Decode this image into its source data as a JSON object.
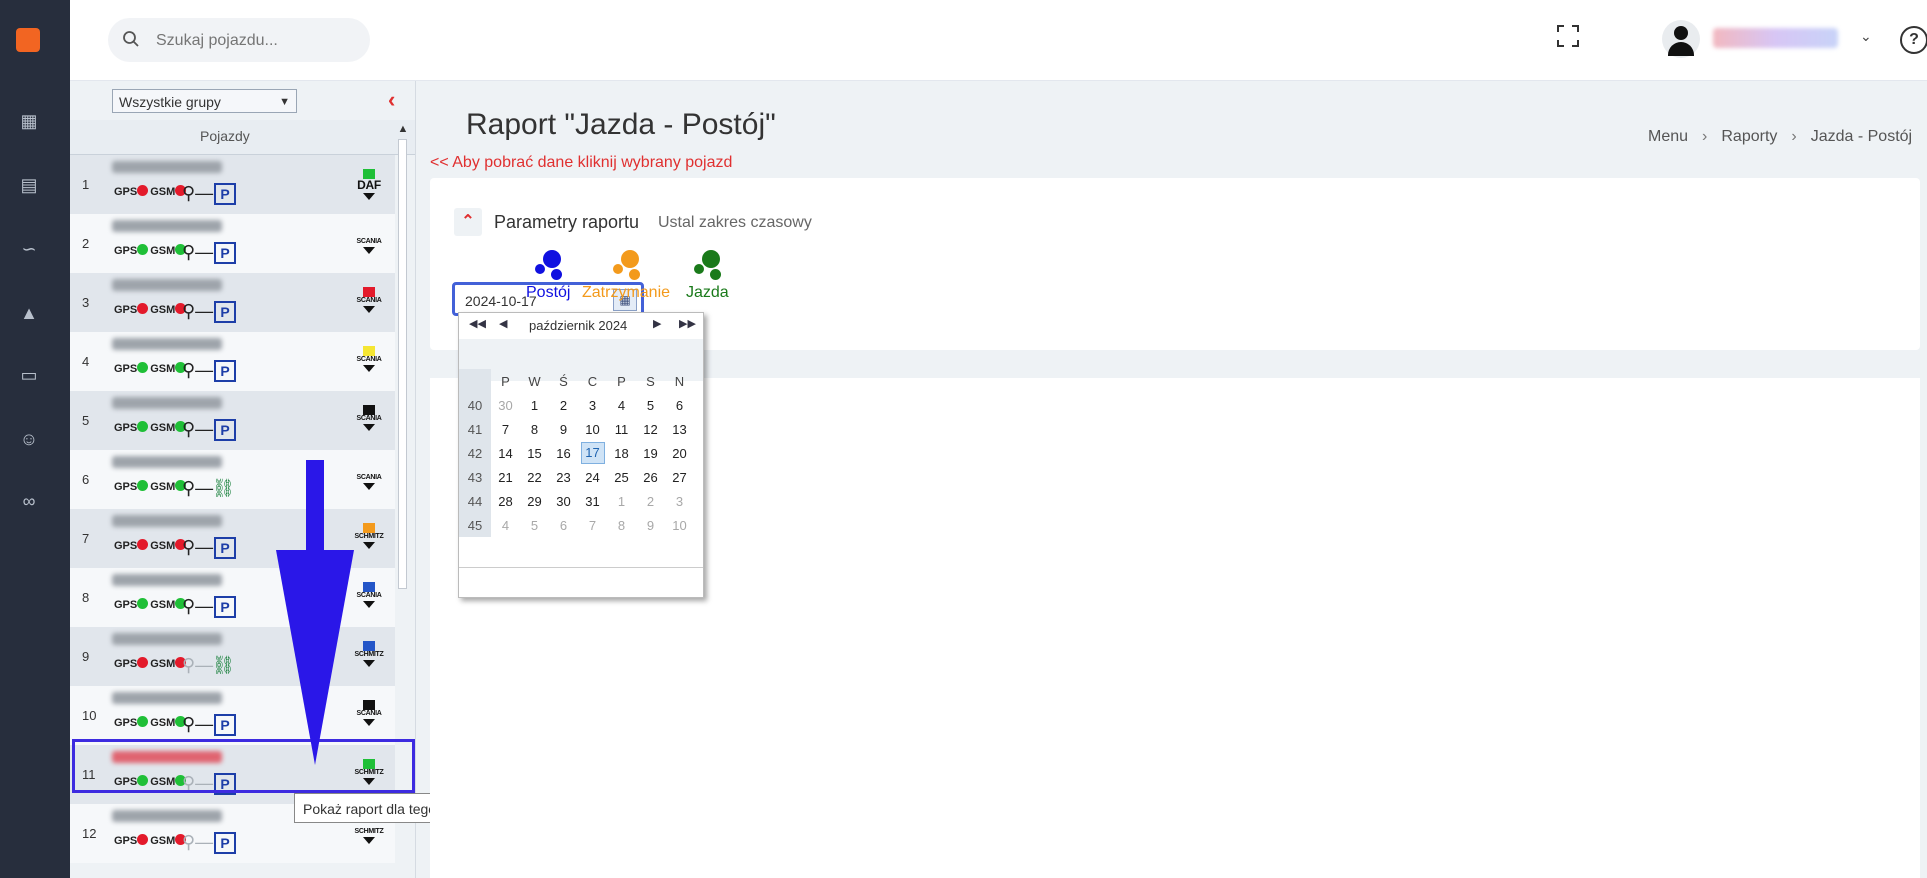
{
  "topbar": {
    "search_placeholder": "Szukaj pojazdu..."
  },
  "left_panel": {
    "group_select": "Wszystkie grupy",
    "column_header": "Pojazdy",
    "tooltip": "Pokaż raport dla tego pojazdu",
    "vehicles": [
      {
        "num": "1",
        "gps": "GPS",
        "gsm": "GSM",
        "gps_status": "red",
        "gsm_status": "red",
        "key": "black",
        "mode": "P",
        "brand": "DAF",
        "flag": "#1fbf37"
      },
      {
        "num": "2",
        "gps": "GPS",
        "gsm": "GSM",
        "gps_status": "green",
        "gsm_status": "green",
        "key": "black",
        "mode": "P",
        "brand": "SCANIA",
        "flag": ""
      },
      {
        "num": "3",
        "gps": "GPS",
        "gsm": "GSM",
        "gps_status": "red",
        "gsm_status": "red",
        "key": "black",
        "mode": "P",
        "brand": "SCANIA",
        "flag": "#e31a2b"
      },
      {
        "num": "4",
        "gps": "GPS",
        "gsm": "GSM",
        "gps_status": "green",
        "gsm_status": "green",
        "key": "black",
        "mode": "P",
        "brand": "SCANIA",
        "flag": "#f5e633"
      },
      {
        "num": "5",
        "gps": "GPS",
        "gsm": "GSM",
        "gps_status": "green",
        "gsm_status": "green",
        "key": "black",
        "mode": "P",
        "brand": "SCANIA",
        "flag": "#111111"
      },
      {
        "num": "6",
        "gps": "GPS",
        "gsm": "GSM",
        "gps_status": "green",
        "gsm_status": "green",
        "key": "black",
        "mode": "car",
        "brand": "SCANIA",
        "flag": ""
      },
      {
        "num": "7",
        "gps": "GPS",
        "gsm": "GSM",
        "gps_status": "red",
        "gsm_status": "red",
        "key": "black",
        "mode": "P",
        "brand": "SCHMITZ",
        "flag": "#f39a1c"
      },
      {
        "num": "8",
        "gps": "GPS",
        "gsm": "GSM",
        "gps_status": "green",
        "gsm_status": "green",
        "key": "black",
        "mode": "P",
        "brand": "SCANIA",
        "flag": "#2456c8"
      },
      {
        "num": "9",
        "gps": "GPS",
        "gsm": "GSM",
        "gps_status": "red",
        "gsm_status": "red",
        "key": "grey",
        "mode": "car",
        "brand": "SCHMITZ",
        "flag": "#2456c8"
      },
      {
        "num": "10",
        "gps": "GPS",
        "gsm": "GSM",
        "gps_status": "green",
        "gsm_status": "green",
        "key": "black",
        "mode": "P",
        "brand": "SCANIA",
        "flag": "#111111"
      },
      {
        "num": "11",
        "gps": "GPS",
        "gsm": "GSM",
        "gps_status": "green",
        "gsm_status": "green",
        "key": "grey",
        "mode": "P",
        "brand": "SCHMITZ",
        "flag": "#1fbf37"
      },
      {
        "num": "12",
        "gps": "GPS",
        "gsm": "GSM",
        "gps_status": "red",
        "gsm_status": "red",
        "key": "grey",
        "mode": "P",
        "brand": "SCHMITZ",
        "flag": ""
      }
    ]
  },
  "main": {
    "title": "Raport \"Jazda - Postój\"",
    "hint": "<< Aby pobrać dane kliknij wybrany pojazd",
    "breadcrumb": [
      "Menu",
      "Raporty",
      "Jazda - Postój"
    ],
    "params_title": "Parametry raportu",
    "params_subtitle": "Ustal zakres czasowy",
    "date_value": "2024-10-17",
    "legend": [
      {
        "label": "Postój",
        "color": "#1010e0"
      },
      {
        "label": "Zatrzymanie",
        "color": "#f39a1c"
      },
      {
        "label": "Jazda",
        "color": "#1a7a1a"
      }
    ]
  },
  "calendar": {
    "month": "październik 2024",
    "weekdays": [
      "P",
      "W",
      "Ś",
      "C",
      "P",
      "S",
      "N"
    ],
    "weeks": [
      {
        "wk": "40",
        "days": [
          "30",
          "1",
          "2",
          "3",
          "4",
          "5",
          "6"
        ]
      },
      {
        "wk": "41",
        "days": [
          "7",
          "8",
          "9",
          "10",
          "11",
          "12",
          "13"
        ]
      },
      {
        "wk": "42",
        "days": [
          "14",
          "15",
          "16",
          "17",
          "18",
          "19",
          "20"
        ]
      },
      {
        "wk": "43",
        "days": [
          "21",
          "22",
          "23",
          "24",
          "25",
          "26",
          "27"
        ]
      },
      {
        "wk": "44",
        "days": [
          "28",
          "29",
          "30",
          "31",
          "1",
          "2",
          "3"
        ]
      },
      {
        "wk": "45",
        "days": [
          "4",
          "5",
          "6",
          "7",
          "8",
          "9",
          "10"
        ]
      }
    ],
    "selected": "17"
  },
  "colors": {
    "sidebar_bg": "#272e3d",
    "accent_red": "#e03030",
    "selection_blue": "#3d2be0"
  }
}
